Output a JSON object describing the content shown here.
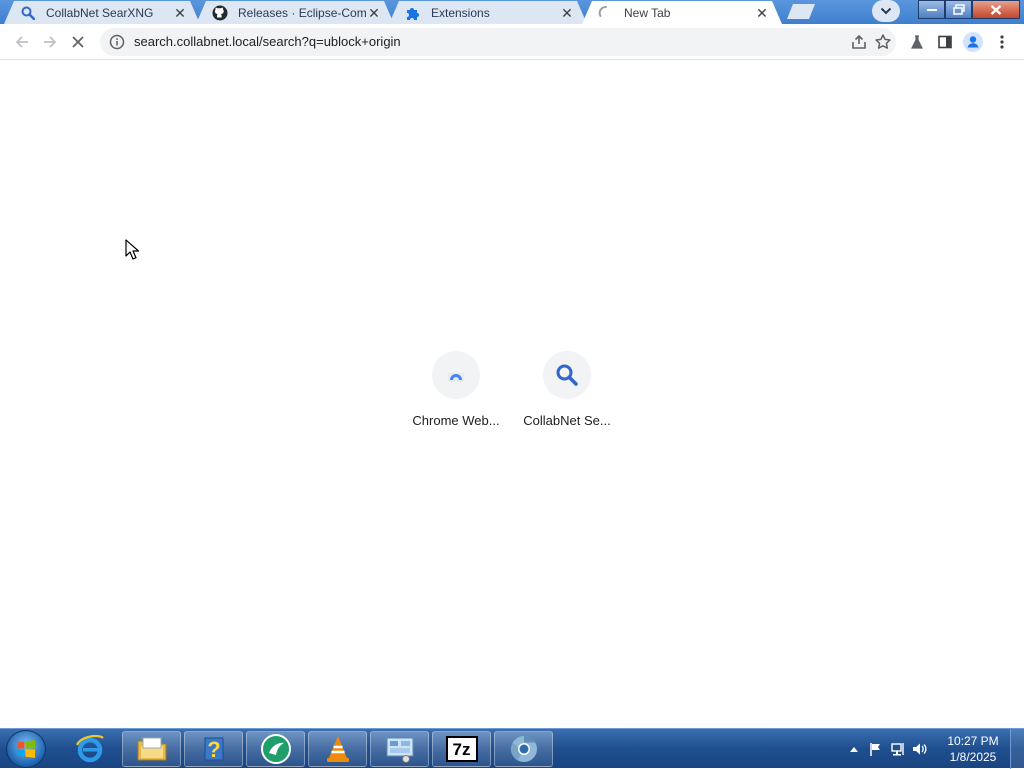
{
  "browser": {
    "tabs": [
      {
        "title": "CollabNet SearXNG",
        "favicon": "search-icon"
      },
      {
        "title": "Releases · Eclipse-Com",
        "favicon": "github-icon"
      },
      {
        "title": "Extensions",
        "favicon": "puzzle-icon"
      },
      {
        "title": "New Tab",
        "favicon": "loading-spinner-icon",
        "active": true
      }
    ],
    "close_glyph": "✕",
    "address": {
      "url": "search.collabnet.local/search?q=ublock+origin"
    }
  },
  "new_tab_page": {
    "shortcuts": [
      {
        "label": "Chrome Web...",
        "icon": "chrome-web-store-icon"
      },
      {
        "label": "CollabNet Se...",
        "icon": "search-icon"
      }
    ]
  },
  "taskbar": {
    "pinned": [
      {
        "name": "internet-explorer-icon"
      },
      {
        "name": "file-explorer-icon"
      },
      {
        "name": "help-icon"
      },
      {
        "name": "app-icon"
      },
      {
        "name": "vlc-icon"
      },
      {
        "name": "control-panel-icon"
      },
      {
        "name": "7zip-icon",
        "text": "7z"
      },
      {
        "name": "chrome-icon"
      }
    ],
    "clock": {
      "time": "10:27 PM",
      "date": "1/8/2025"
    }
  },
  "colors": {
    "accent_blue": "#1a73e8",
    "tab_strip": "#4a8ad6",
    "taskbar": "#1f4f8f"
  }
}
